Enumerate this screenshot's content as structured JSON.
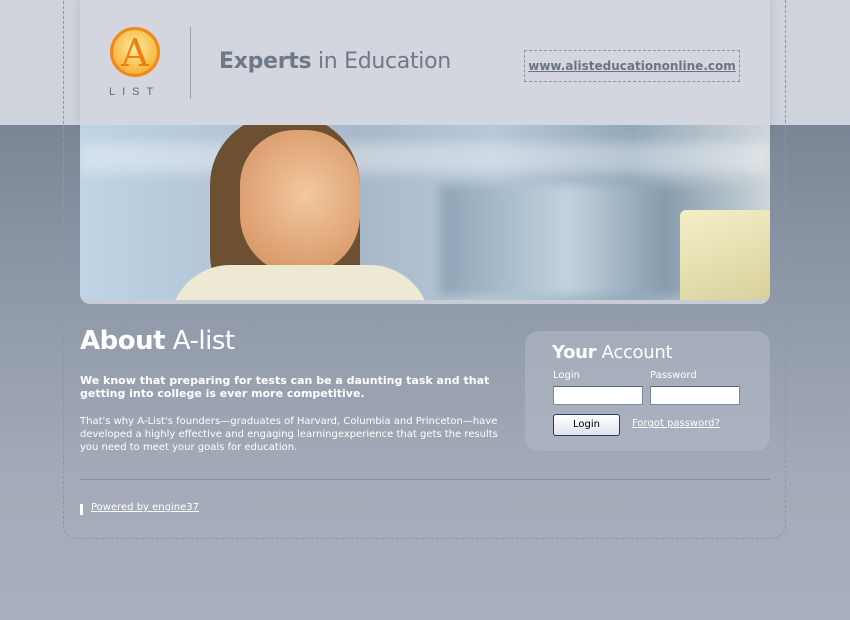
{
  "header": {
    "logo_letter": "A",
    "logo_text": "LIST",
    "tagline_bold": "Experts",
    "tagline_rest": " in Education",
    "url": "www.alisteducationonline.com"
  },
  "about": {
    "title_bold": "About",
    "title_rest": " A-list",
    "intro_bold": "We know that preparing for tests can be a daunting task and that getting into college is ever more competitive.",
    "intro_text": "That's why A-List's founders—graduates of Harvard, Columbia and Princeton—have developed a highly effective and engaging learningexperience that gets the results you need to meet your goals for education."
  },
  "account": {
    "title_bold": "Your",
    "title_rest": " Account",
    "login_label": "Login",
    "password_label": "Password",
    "login_value": "",
    "password_value": "",
    "login_button": "Login",
    "forgot_link": "Forgot password?"
  },
  "footer": {
    "powered_by": "Powered by engine37"
  },
  "colors": {
    "logo_orange": "#f08a14",
    "header_bg": "#d3d6de",
    "body_bg": "#8b95a5"
  }
}
